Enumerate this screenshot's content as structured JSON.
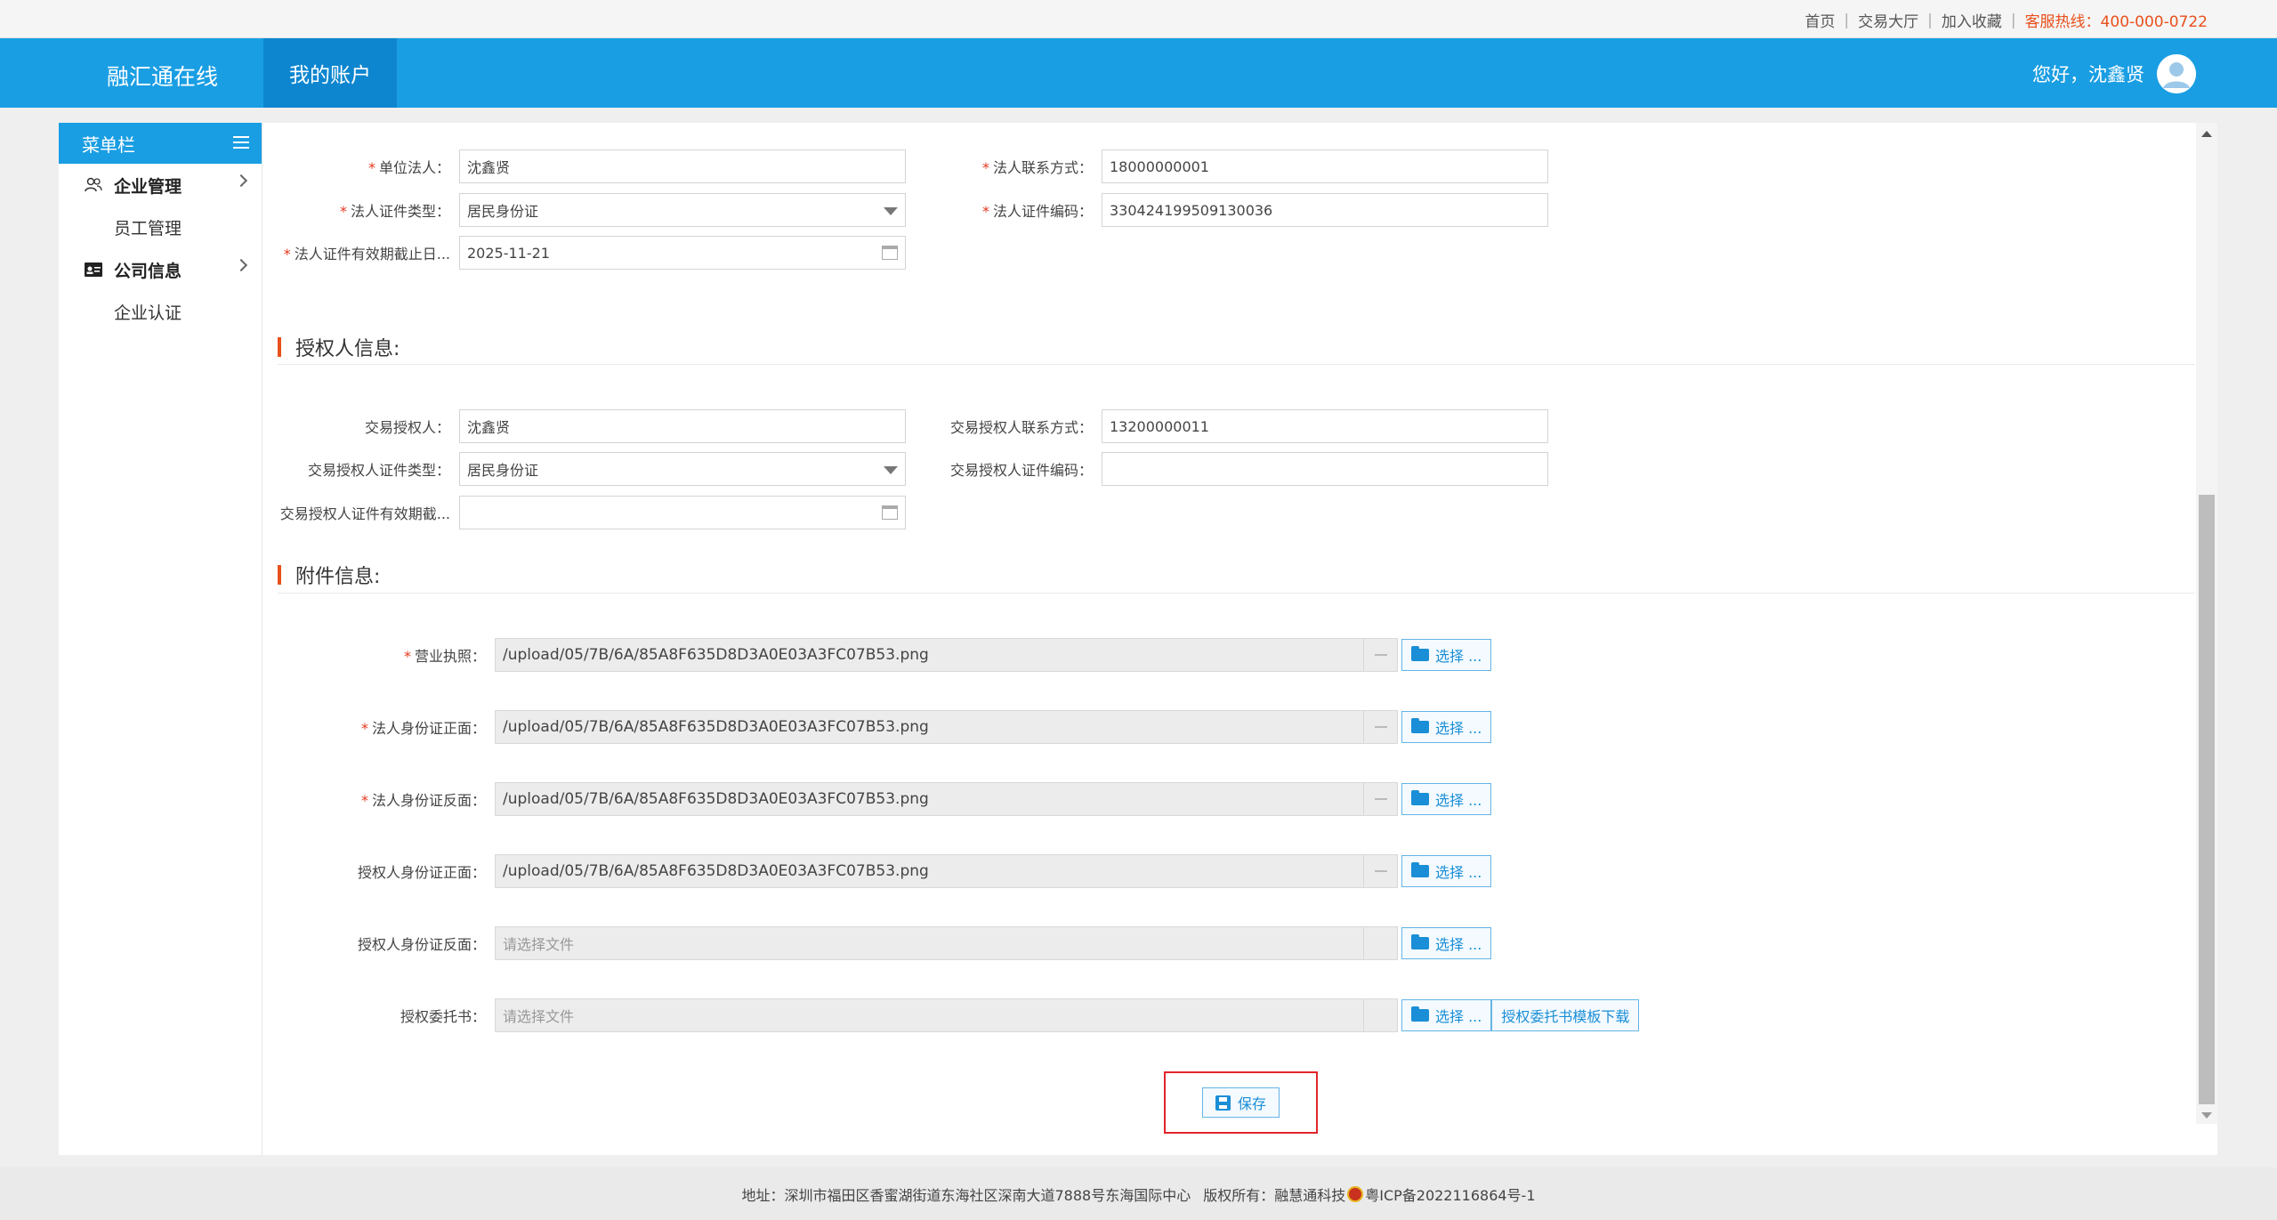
{
  "topbar": {
    "home": "首页",
    "trade_hall": "交易大厅",
    "favorite": "加入收藏",
    "hotline": "客服热线：400-000-0722"
  },
  "header": {
    "brand": "融汇通在线",
    "nav_tab": "我的账户",
    "greeting": "您好，沈鑫贤"
  },
  "sidebar": {
    "title": "菜单栏",
    "groups": [
      {
        "label": "企业管理",
        "icon": "users-icon",
        "items": [
          "员工管理"
        ]
      },
      {
        "label": "公司信息",
        "icon": "id-card-icon",
        "items": [
          "企业认证"
        ]
      }
    ]
  },
  "legal": {
    "rep_label": "单位法人：",
    "rep_value": "沈鑫贤",
    "phone_label": "法人联系方式：",
    "phone_value": "18000000001",
    "id_type_label": "法人证件类型：",
    "id_type_value": "居民身份证",
    "id_no_label": "法人证件编码：",
    "id_no_value": "330424199509130036",
    "expiry_label": "法人证件有效期截止日...",
    "expiry_value": "2025-11-21"
  },
  "authorized": {
    "section_title": "授权人信息:",
    "name_label": "交易授权人：",
    "name_value": "沈鑫贤",
    "phone_label": "交易授权人联系方式：",
    "phone_value": "13200000011",
    "id_type_label": "交易授权人证件类型：",
    "id_type_value": "居民身份证",
    "id_no_label": "交易授权人证件编码：",
    "id_no_value": "",
    "expiry_label": "交易授权人证件有效期截...",
    "expiry_value": ""
  },
  "attachments": {
    "section_title": "附件信息:",
    "choose_label": "选择 ...",
    "template_download": "授权委托书模板下载",
    "items": [
      {
        "label": "营业执照：",
        "required": true,
        "value": "/upload/05/7B/6A/85A8F635D8D3A0E03A3FC07B53.png"
      },
      {
        "label": "法人身份证正面：",
        "required": true,
        "value": "/upload/05/7B/6A/85A8F635D8D3A0E03A3FC07B53.png"
      },
      {
        "label": "法人身份证反面：",
        "required": true,
        "value": "/upload/05/7B/6A/85A8F635D8D3A0E03A3FC07B53.png"
      },
      {
        "label": "授权人身份证正面：",
        "required": false,
        "value": "/upload/05/7B/6A/85A8F635D8D3A0E03A3FC07B53.png"
      },
      {
        "label": "授权人身份证反面：",
        "required": false,
        "value": "",
        "placeholder": "请选择文件"
      },
      {
        "label": "授权委托书：",
        "required": false,
        "value": "",
        "placeholder": "请选择文件"
      }
    ]
  },
  "save_label": "保存",
  "footer": {
    "address": "地址：深圳市福田区香蜜湖街道东海社区深南大道7888号东海国际中心",
    "copyright": "版权所有：融慧通科技",
    "icp": "粤ICP备2022116864号-1"
  },
  "colors": {
    "primary": "#1a9ee3",
    "nav_active": "#0d86cf",
    "accent": "#e8501c",
    "required": "#e3371e",
    "highlight_box": "#e0252a"
  }
}
